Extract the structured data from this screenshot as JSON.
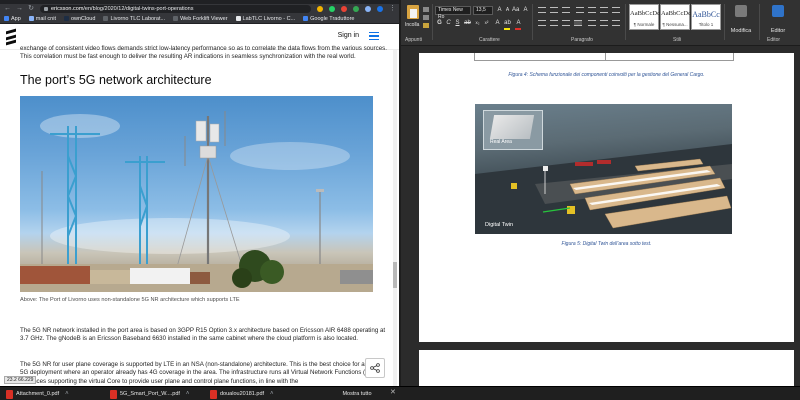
{
  "browser": {
    "url_domain": "ericsson.com",
    "url_path": "/en/blog/2020/12/digital-twins-port-operations",
    "bookmarks": [
      {
        "label": "App",
        "color": "#4285f4"
      },
      {
        "label": "mail cnit",
        "color": "#8ab4f8"
      },
      {
        "label": "ownCloud",
        "color": "#1d2d44"
      },
      {
        "label": "Livorno TLC Laborat...",
        "color": "#5f6368"
      },
      {
        "label": "Web Forklift Viewer",
        "color": "#5f6368"
      },
      {
        "label": "LabTLC Livorno - C...",
        "color": "#e8eaed"
      },
      {
        "label": "Google Traduttore",
        "color": "#4285f4"
      }
    ],
    "header": {
      "signin": "Sign in"
    },
    "article": {
      "intro": "exchange of consistent video flows demands strict low-latency performance so as to correlate the data flows from the various sources. This correlation must be fast enough to deliver the resulting AR indications in seamless synchronization with the real world.",
      "heading": "The port’s 5G network architecture",
      "caption": "Above: The Port of Livorno uses non-standalone 5G NR architecture which supports LTE",
      "body2": "The 5G NR network installed in the port area is based on 3GPP R15 Option 3.x architecture based on Ericsson AIR 6488 operating at 3.7 GHz. The gNodeB is an Ericsson Baseband 6630 installed in the same cabinet where the cloud platform is also located.",
      "body3": "The 5G NR for user plane coverage is supported by LTE in an NSA (non-standalone) architecture. This is the best choice for an initial 5G deployment where an operator already has 4G coverage in the area. The infrastructure runs all Virtual Network Functions (VNF) instances supporting the virtual Core to provide user plane and control plane functions, in line with the"
    },
    "coord_readout": "23.2 66.229"
  },
  "word": {
    "ribbon": {
      "paste_label": "Incolla",
      "font_name": "Times New Ro",
      "font_size": "13,5",
      "groups": {
        "clipboard": "Appunti",
        "font": "Carattere",
        "paragraph": "Paragrafo",
        "styles": "Stili",
        "editor": "Editor"
      },
      "styles": [
        {
          "sample": "AaBbCcDc",
          "name": "¶ Normale"
        },
        {
          "sample": "AaBbCcDc",
          "name": "¶ Nessuna..."
        },
        {
          "sample": "AaBbCc",
          "name": "Titolo 1"
        }
      ],
      "modifica": "Modifica",
      "editor": "Editor"
    },
    "page": {
      "fig4_caption": "Figura 4: Schema funzionale dei componenti coinvolti per la gestione del General Cargo.",
      "fig5_caption": "Figura 5: Digital Twin dell’area sotto test.",
      "fig5_labels": {
        "real": "Real Area",
        "twin": "Digital Twin"
      }
    }
  },
  "downloads": {
    "items": [
      {
        "label": "Attachment_0.pdf"
      },
      {
        "label": "5G_Smart_Port_W....pdf"
      },
      {
        "label": "doualou20181.pdf"
      }
    ],
    "show_all": "Mostra tutto"
  }
}
